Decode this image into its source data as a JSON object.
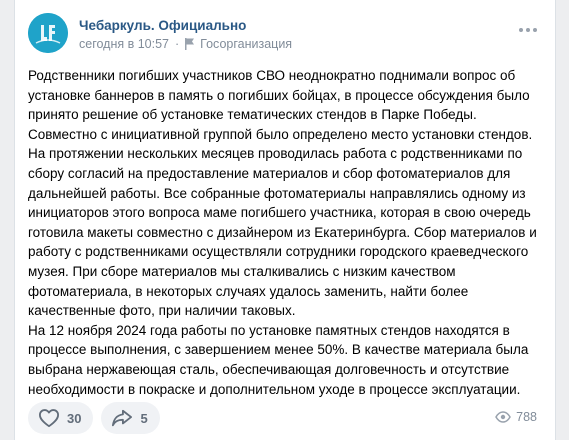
{
  "post": {
    "author": "Чебаркуль. Официально",
    "time": "сегодня в 10:57",
    "separator": "·",
    "org_type": "Госорганизация",
    "text_main": "Родственники погибших участников СВО  неоднократно поднимали вопрос об установке баннеров  в память о погибших бойцах, в процессе обсуждения было принято решение об установке тематических стендов в Парке Победы. Совместно с инициативной группой было определено место установки стендов. На протяжении нескольких месяцев проводилась работа с родственниками по сбору согласий на предоставление материалов и сбор фотоматериалов для дальнейшей работы. Все собранные фотоматериалы направлялись одному из инициаторов этого вопроса маме погибшего участника, которая в свою очередь готовила макеты совместно с дизайнером из Екатеринбурга. Сбор материалов и работу с родственниками осуществляли сотрудники городского краеведческого музея. При сборе материалов мы сталкивались с низким качеством фотоматериала, в некоторых случаях удалось заменить, найти более качественные фото, при наличии таковых.",
    "text_second": "На 12 ноября 2024 года работы по установке памятных стендов находятся в процессе выполнения, с завершением менее 50%. В качестве материала была выбрана нержавеющая сталь, обеспечивающая долговечность и отсутствие необходимости в покраске и дополнительном уходе в процессе эксплуатации."
  },
  "actions": {
    "likes": "30",
    "shares": "5",
    "views": "788"
  },
  "icons": {
    "avatar": "city-logo-icon",
    "flag": "flag-icon",
    "more": "more-dots-icon",
    "like": "heart-icon",
    "share": "share-arrow-icon",
    "views": "eye-icon"
  },
  "colors": {
    "author": "#2a5885",
    "meta": "#818c99",
    "avatar_bg": "#1fa3c9",
    "button_bg": "#f0f2f5"
  }
}
